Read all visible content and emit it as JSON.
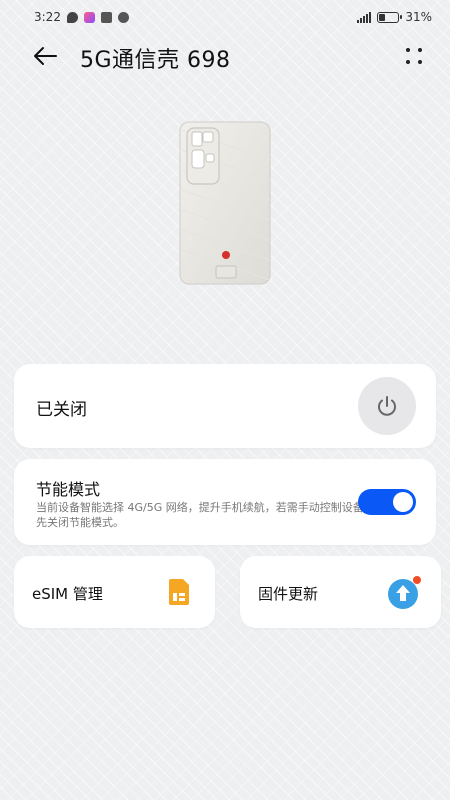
{
  "status_bar": {
    "time": "3:22",
    "battery": "31%",
    "battery_level": 0.31,
    "notification_icons": [
      "chat-bubble-icon",
      "app-notification-icon",
      "mail-icon",
      "sync-icon"
    ]
  },
  "app_bar": {
    "title": "5G通信壳 698",
    "back_icon": "arrow-left-icon",
    "more_icon": "four-dots-icon"
  },
  "device": {
    "image": "phone-case-image"
  },
  "power_card": {
    "label": "已关闭",
    "icon": "power-icon"
  },
  "eco_card": {
    "title": "节能模式",
    "description": "当前设备智能选择 4G/5G 网络，提升手机续航，若需手动控制设备先关闭节能模式。",
    "enabled": true
  },
  "esim_card": {
    "label": "eSIM 管理",
    "icon": "sim-card-icon",
    "icon_color": "#f5a623"
  },
  "firmware_card": {
    "label": "固件更新",
    "icon": "upload-arrow-icon",
    "icon_color": "#3aa0e6",
    "badge_color": "#f04e23"
  },
  "colors": {
    "accent": "#0a59f7",
    "background": "#eeeff1",
    "card": "#ffffff"
  }
}
